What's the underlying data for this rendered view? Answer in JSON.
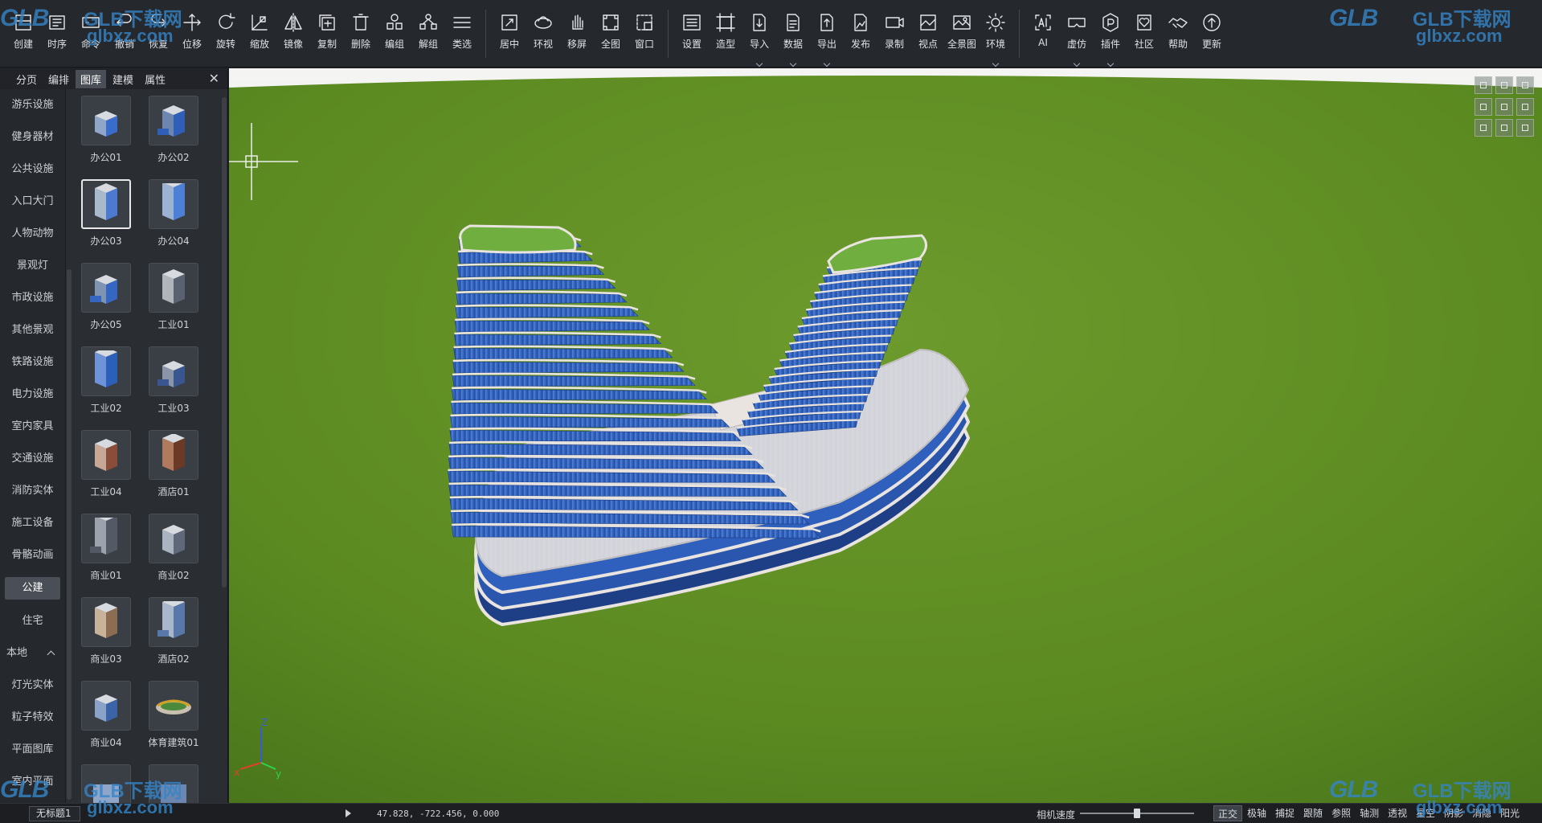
{
  "toolbar": {
    "groups": [
      [
        {
          "label": "创建",
          "icon": "create-icon"
        },
        {
          "label": "时序",
          "icon": "timeline-icon"
        },
        {
          "label": "命令",
          "icon": "command-icon"
        },
        {
          "label": "撤销",
          "icon": "undo-icon"
        },
        {
          "label": "恢复",
          "icon": "redo-icon"
        },
        {
          "label": "位移",
          "icon": "move-icon"
        },
        {
          "label": "旋转",
          "icon": "rotate-icon"
        },
        {
          "label": "缩放",
          "icon": "scale-icon"
        },
        {
          "label": "镜像",
          "icon": "mirror-icon"
        },
        {
          "label": "复制",
          "icon": "copy-icon"
        },
        {
          "label": "删除",
          "icon": "delete-icon"
        },
        {
          "label": "编组",
          "icon": "group-icon"
        },
        {
          "label": "解组",
          "icon": "ungroup-icon"
        },
        {
          "label": "类选",
          "icon": "class-select-icon"
        }
      ],
      [
        {
          "label": "居中",
          "icon": "center-icon"
        },
        {
          "label": "环视",
          "icon": "orbit-icon"
        },
        {
          "label": "移屏",
          "icon": "pan-hand-icon"
        },
        {
          "label": "全图",
          "icon": "zoom-extents-icon"
        },
        {
          "label": "窗口",
          "icon": "zoom-window-icon"
        }
      ],
      [
        {
          "label": "设置",
          "icon": "settings-icon"
        },
        {
          "label": "造型",
          "icon": "modeling-icon"
        },
        {
          "label": "导入",
          "icon": "import-icon",
          "dropdown": true
        },
        {
          "label": "数据",
          "icon": "data-icon",
          "dropdown": true
        },
        {
          "label": "导出",
          "icon": "export-icon",
          "dropdown": true
        },
        {
          "label": "发布",
          "icon": "publish-icon"
        },
        {
          "label": "录制",
          "icon": "record-icon"
        },
        {
          "label": "视点",
          "icon": "viewpoint-icon"
        },
        {
          "label": "全景图",
          "icon": "panorama-icon"
        },
        {
          "label": "环境",
          "icon": "environment-sun-icon",
          "dropdown": true
        }
      ],
      [
        {
          "label": "AI",
          "icon": "ai-icon"
        },
        {
          "label": "虚仿",
          "icon": "vr-icon",
          "dropdown": true
        },
        {
          "label": "插件",
          "icon": "plugin-icon",
          "dropdown": true
        },
        {
          "label": "社区",
          "icon": "community-icon"
        },
        {
          "label": "帮助",
          "icon": "help-handshake-icon"
        },
        {
          "label": "更新",
          "icon": "update-icon"
        }
      ]
    ]
  },
  "watermark": {
    "logo": "GLB",
    "text1": "GLB下载网",
    "text2": "glbxz.com"
  },
  "panel": {
    "tabs": [
      "分页",
      "编排",
      "图库",
      "建模",
      "属性"
    ],
    "active_tab": "图库",
    "close_glyph": "✕",
    "categories": [
      {
        "label": "游乐设施"
      },
      {
        "label": "健身器材"
      },
      {
        "label": "公共设施"
      },
      {
        "label": "入口大门"
      },
      {
        "label": "人物动物"
      },
      {
        "label": "景观灯"
      },
      {
        "label": "市政设施"
      },
      {
        "label": "其他景观"
      },
      {
        "label": "铁路设施"
      },
      {
        "label": "电力设施"
      },
      {
        "label": "室内家具"
      },
      {
        "label": "交通设施"
      },
      {
        "label": "消防实体"
      },
      {
        "label": "施工设备"
      },
      {
        "label": "骨骼动画"
      },
      {
        "label": "公建",
        "active": true
      },
      {
        "label": "住宅"
      },
      {
        "label": "本地",
        "group": true
      },
      {
        "label": "灯光实体"
      },
      {
        "label": "粒子特效"
      },
      {
        "label": "平面图库"
      },
      {
        "label": "室内平面"
      }
    ],
    "thumbnails": [
      {
        "label": "办公01",
        "icon": "office-tower-thumb-icon"
      },
      {
        "label": "办公02",
        "icon": "office-complex-thumb-icon"
      },
      {
        "label": "办公03",
        "icon": "office-curved-thumb-icon",
        "selected": true
      },
      {
        "label": "办公04",
        "icon": "office-twin-thumb-icon"
      },
      {
        "label": "办公05",
        "icon": "office-block-thumb-icon"
      },
      {
        "label": "工业01",
        "icon": "industrial-hall-thumb-icon"
      },
      {
        "label": "工业02",
        "icon": "industrial-roof-thumb-icon"
      },
      {
        "label": "工业03",
        "icon": "industrial-plant-thumb-icon"
      },
      {
        "label": "工业04",
        "icon": "industrial-warehouse-thumb-icon"
      },
      {
        "label": "酒店01",
        "icon": "hotel-thumb-icon"
      },
      {
        "label": "商业01",
        "icon": "commercial-l-thumb-icon"
      },
      {
        "label": "商业02",
        "icon": "commercial-cluster-thumb-icon"
      },
      {
        "label": "商业03",
        "icon": "commercial-strip-thumb-icon"
      },
      {
        "label": "酒店02",
        "icon": "hotel-tower-thumb-icon"
      },
      {
        "label": "商业04",
        "icon": "commercial-mall-thumb-icon"
      },
      {
        "label": "体育建筑01",
        "icon": "stadium-thumb-icon"
      },
      {
        "label": "",
        "icon": "partial-thumb-icon"
      },
      {
        "label": "",
        "icon": "partial-thumb-icon"
      }
    ]
  },
  "viewport": {
    "colors": {
      "sky": "#eef0ee",
      "horizon": "#8fbc7a",
      "ground": "#5b8a21",
      "glass": "#3b6fc9",
      "glass_dark": "#1d3f8a",
      "slab": "#e9e4df",
      "roof": "#6fae3f"
    },
    "nav_icons": [
      "nav-top-left-icon",
      "nav-top-icon",
      "nav-top-right-icon",
      "nav-left-icon",
      "nav-center-icon",
      "nav-right-icon",
      "nav-bottom-left-icon",
      "nav-bottom-icon",
      "nav-bottom-right-icon"
    ],
    "axis": {
      "x": "x",
      "y": "y",
      "z": "Z"
    }
  },
  "status": {
    "document": "无标题1",
    "coords": "47.828, -722.456, 0.000",
    "camera_speed_label": "相机速度",
    "camera_speed": 0.5,
    "modes": [
      {
        "label": "正交",
        "on": true
      },
      {
        "label": "极轴"
      },
      {
        "label": "捕捉"
      },
      {
        "label": "跟随"
      },
      {
        "label": "参照"
      },
      {
        "label": "轴测"
      },
      {
        "label": "透视"
      },
      {
        "label": "星空"
      },
      {
        "label": "阴影"
      },
      {
        "label": "消隐"
      },
      {
        "label": "阳光"
      }
    ]
  }
}
